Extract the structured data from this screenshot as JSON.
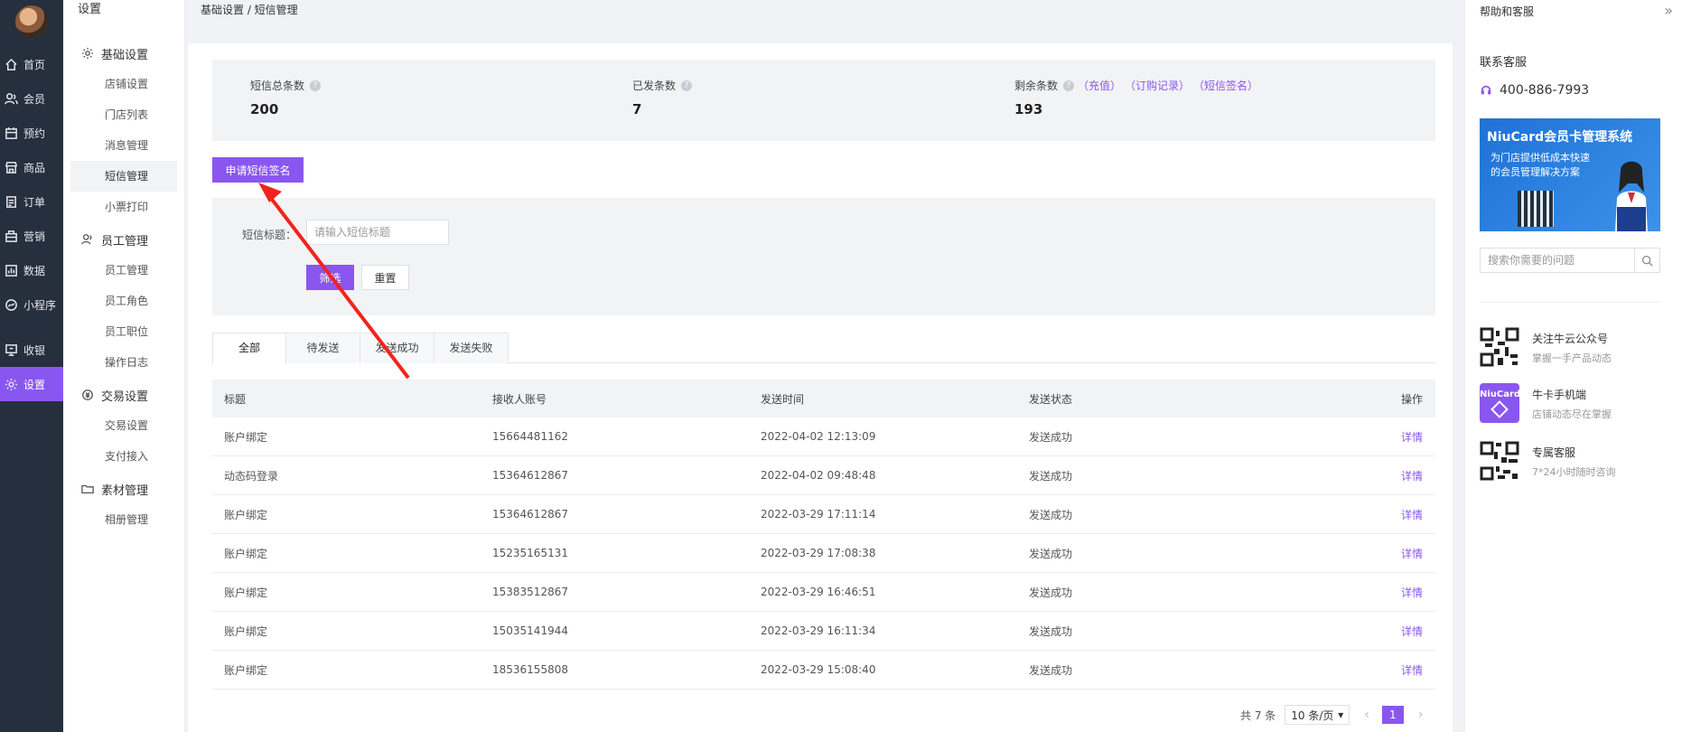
{
  "nav": {
    "items": [
      {
        "label": "首页",
        "icon": "home-icon"
      },
      {
        "label": "会员",
        "icon": "users-icon"
      },
      {
        "label": "预约",
        "icon": "calendar-icon"
      },
      {
        "label": "商品",
        "icon": "shop-icon"
      },
      {
        "label": "订单",
        "icon": "order-icon"
      },
      {
        "label": "营销",
        "icon": "marketing-icon"
      },
      {
        "label": "数据",
        "icon": "chart-icon"
      },
      {
        "label": "小程序",
        "icon": "miniapp-icon"
      },
      {
        "label": "收银",
        "icon": "cashier-icon"
      },
      {
        "label": "设置",
        "icon": "gear-icon"
      }
    ],
    "accent": "#8a56f0"
  },
  "sidebar": {
    "title": "设置",
    "groups": [
      {
        "label": "基础设置",
        "items": [
          "店铺设置",
          "门店列表",
          "消息管理",
          "短信管理",
          "小票打印"
        ]
      },
      {
        "label": "员工管理",
        "items": [
          "员工管理",
          "员工角色",
          "员工职位",
          "操作日志"
        ]
      },
      {
        "label": "交易设置",
        "items": [
          "交易设置",
          "支付接入"
        ]
      },
      {
        "label": "素材管理",
        "items": [
          "相册管理"
        ]
      }
    ]
  },
  "breadcrumb": "基础设置 / 短信管理",
  "stats": {
    "total_label": "短信总条数",
    "total_value": "200",
    "sent_label": "已发条数",
    "sent_value": "7",
    "remain_label": "剩余条数",
    "remain_value": "193",
    "link_recharge": "（充值）",
    "link_orders": "（订购记录）",
    "link_sign": "（短信签名）"
  },
  "apply_button": "申请短信签名",
  "filter": {
    "label": "短信标题：",
    "placeholder": "请输入短信标题",
    "search": "筛选",
    "reset": "重置"
  },
  "tabs": [
    "全部",
    "待发送",
    "发送成功",
    "发送失败"
  ],
  "table": {
    "headers": [
      "标题",
      "接收人账号",
      "发送时间",
      "发送状态",
      "操作"
    ],
    "rows": [
      [
        "账户绑定",
        "15664481162",
        "2022-04-02 12:13:09",
        "发送成功",
        "详情"
      ],
      [
        "动态码登录",
        "15364612867",
        "2022-04-02 09:48:48",
        "发送成功",
        "详情"
      ],
      [
        "账户绑定",
        "15364612867",
        "2022-03-29 17:11:14",
        "发送成功",
        "详情"
      ],
      [
        "账户绑定",
        "15235165131",
        "2022-03-29 17:08:38",
        "发送成功",
        "详情"
      ],
      [
        "账户绑定",
        "15383512867",
        "2022-03-29 16:46:51",
        "发送成功",
        "详情"
      ],
      [
        "账户绑定",
        "15035141944",
        "2022-03-29 16:11:34",
        "发送成功",
        "详情"
      ],
      [
        "账户绑定",
        "18536155808",
        "2022-03-29 15:08:40",
        "发送成功",
        "详情"
      ]
    ]
  },
  "pager": {
    "total": "共 7 条",
    "per_page": "10 条/页",
    "page": "1"
  },
  "help": {
    "title": "帮助和客服",
    "cs_title": "联系客服",
    "phone": "400-886-7993",
    "banner_title": "NiuCard会员卡管理系统",
    "banner_sub": "为门店提供低成本快速的会员管理解决方案",
    "search_placeholder": "搜索你需要的问题",
    "items": [
      {
        "title": "关注牛云公众号",
        "sub": "掌握一手产品动态"
      },
      {
        "title": "牛卡手机端",
        "sub": "店铺动态尽在掌握"
      },
      {
        "title": "专属客服",
        "sub": "7*24小时随时咨询"
      }
    ],
    "logo_text": "NiuCard"
  }
}
